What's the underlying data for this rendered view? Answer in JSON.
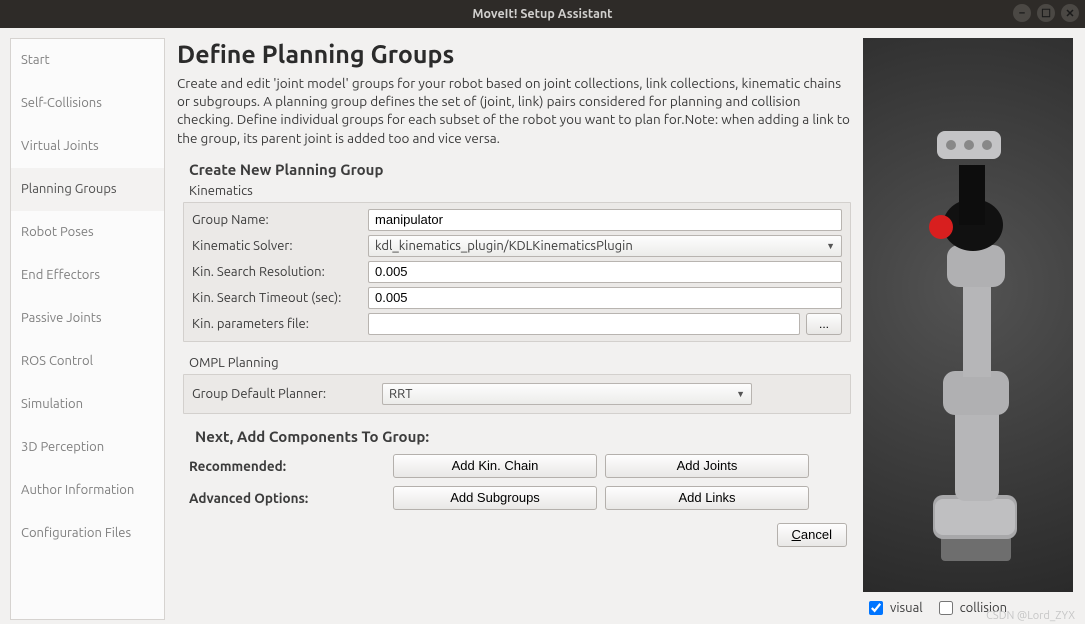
{
  "window": {
    "title": "MoveIt! Setup Assistant"
  },
  "sidebar": {
    "items": [
      {
        "label": "Start"
      },
      {
        "label": "Self-Collisions"
      },
      {
        "label": "Virtual Joints"
      },
      {
        "label": "Planning Groups"
      },
      {
        "label": "Robot Poses"
      },
      {
        "label": "End Effectors"
      },
      {
        "label": "Passive Joints"
      },
      {
        "label": "ROS Control"
      },
      {
        "label": "Simulation"
      },
      {
        "label": "3D Perception"
      },
      {
        "label": "Author Information"
      },
      {
        "label": "Configuration Files"
      }
    ]
  },
  "page": {
    "heading": "Define Planning Groups",
    "description": "Create and edit 'joint model' groups for your robot based on joint collections, link collections, kinematic chains or subgroups. A planning group defines the set of (joint, link) pairs considered for planning and collision checking. Define individual groups for each subset of the robot you want to plan for.Note: when adding a link to the group, its parent joint is added too and vice versa.",
    "create_title": "Create New Planning Group",
    "kinematics_label": "Kinematics",
    "group_name_label": "Group Name:",
    "group_name_value": "manipulator",
    "solver_label": "Kinematic Solver:",
    "solver_value": "kdl_kinematics_plugin/KDLKinematicsPlugin",
    "search_res_label": "Kin. Search Resolution:",
    "search_res_value": "0.005",
    "search_timeout_label": "Kin. Search Timeout (sec):",
    "search_timeout_value": "0.005",
    "params_file_label": "Kin. parameters file:",
    "params_file_value": "",
    "browse_label": "...",
    "ompl_heading": "OMPL Planning",
    "default_planner_label": "Group Default Planner:",
    "default_planner_value": "RRT",
    "next_heading": "Next, Add Components To Group:",
    "recommended_label": "Recommended:",
    "advanced_label": "Advanced Options:",
    "add_kin_chain": "Add Kin. Chain",
    "add_joints": "Add Joints",
    "add_subgroups": "Add Subgroups",
    "add_links": "Add Links",
    "cancel": "Cancel"
  },
  "viewer": {
    "visual_label": "visual",
    "collision_label": "collision",
    "visual_checked": "true",
    "collision_checked": "false"
  },
  "watermark": "CSDN @Lord_ZYX"
}
